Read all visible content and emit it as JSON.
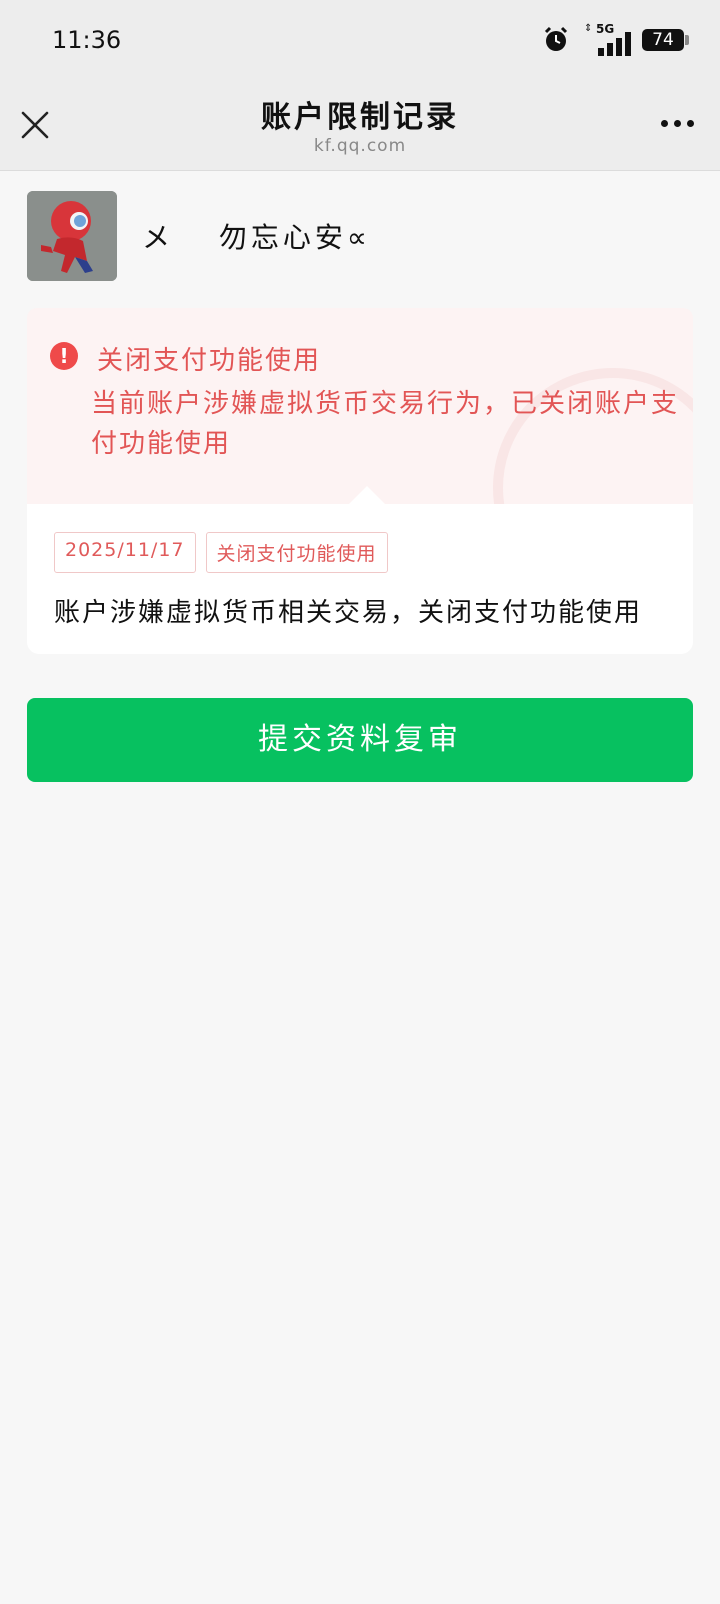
{
  "status_bar": {
    "time": "11:36",
    "network": "5G",
    "battery": "74"
  },
  "header": {
    "title": "账户限制记录",
    "subtitle": "kf.qq.com",
    "close_icon": "close-icon",
    "more_icon": "more-icon"
  },
  "user": {
    "name": "メ　 勿忘心安∝",
    "avatar_icon": "avatar-image"
  },
  "alert": {
    "title": "关闭支付功能使用",
    "description": "当前账户涉嫌虚拟货币交易行为，已关闭账户支付功能使用",
    "icon": "warning-icon",
    "color": "#e25555"
  },
  "record": {
    "date": "2025/11/17",
    "type": "关闭支付功能使用",
    "detail": "账户涉嫌虚拟货币相关交易，关闭支付功能使用"
  },
  "actions": {
    "submit_label": "提交资料复审",
    "submit_color": "#07c160"
  }
}
